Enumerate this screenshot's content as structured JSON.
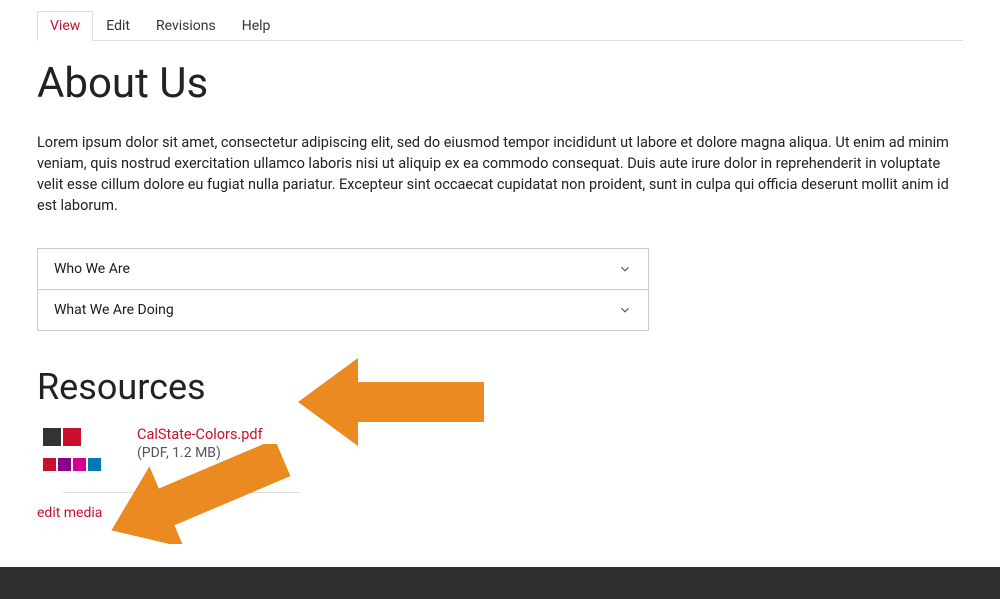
{
  "tabs": {
    "items": [
      {
        "label": "View",
        "active": true
      },
      {
        "label": "Edit",
        "active": false
      },
      {
        "label": "Revisions",
        "active": false
      },
      {
        "label": "Help",
        "active": false
      }
    ]
  },
  "page": {
    "title": "About Us",
    "body": "Lorem ipsum dolor sit amet, consectetur adipiscing elit, sed do eiusmod tempor incididunt ut labore et dolore magna aliqua. Ut enim ad minim veniam, quis nostrud exercitation ullamco laboris nisi ut aliquip ex ea commodo consequat. Duis aute irure dolor in reprehenderit in voluptate velit esse cillum dolore eu fugiat nulla pariatur. Excepteur sint occaecat cupidatat non proident, sunt in culpa qui officia deserunt mollit anim id est laborum."
  },
  "accordion": {
    "items": [
      {
        "label": "Who We Are"
      },
      {
        "label": "What We Are Doing"
      }
    ]
  },
  "resources": {
    "heading": "Resources",
    "file": {
      "name": "CalState-Colors.pdf",
      "meta": "(PDF, 1.2 MB)"
    },
    "edit_link": "edit media"
  },
  "colors": {
    "accent": "#c8102e",
    "arrow": "#ec8a22",
    "footer": "#2f2f2f"
  }
}
